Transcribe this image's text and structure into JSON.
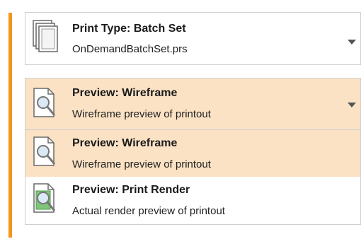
{
  "print_type": {
    "title": "Print Type: Batch Set",
    "subtitle": "OnDemandBatchSet.prs",
    "icon": "batch-documents-icon"
  },
  "preview_selector": {
    "selected": {
      "title": "Preview: Wireframe",
      "subtitle": "Wireframe preview of printout",
      "icon": "wireframe-preview-icon"
    },
    "options": [
      {
        "title": "Preview: Wireframe",
        "subtitle": "Wireframe preview of printout",
        "icon": "wireframe-preview-icon",
        "highlighted": true
      },
      {
        "title": "Preview: Print Render",
        "subtitle": "Actual render preview of printout",
        "icon": "render-preview-icon",
        "highlighted": false
      }
    ]
  },
  "colors": {
    "accent": "#f2951a",
    "selection": "#fbe2c4",
    "border": "#cfcfcf"
  }
}
